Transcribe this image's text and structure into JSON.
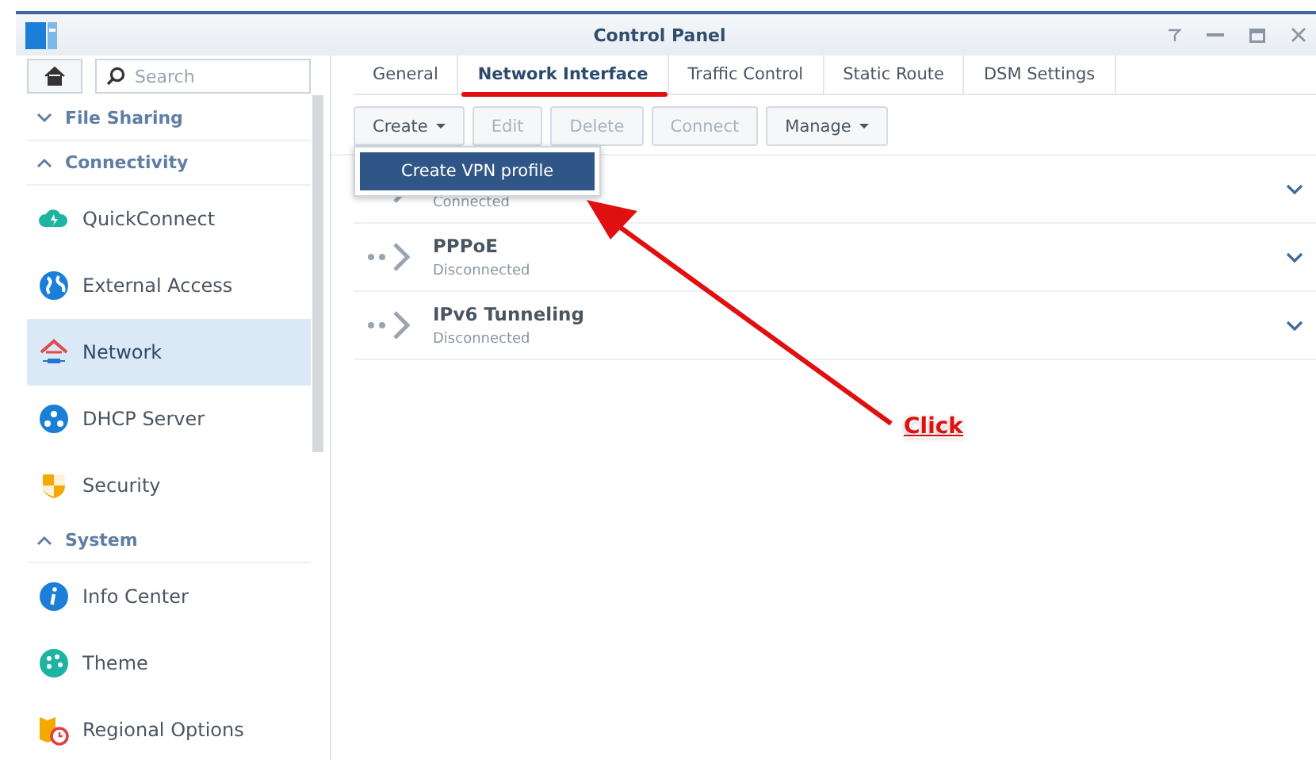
{
  "window": {
    "title": "Control Panel"
  },
  "sidebar": {
    "search": {
      "placeholder": "Search"
    },
    "items": [
      {
        "kind": "section",
        "label": "File Sharing",
        "expanded": false
      },
      {
        "kind": "section",
        "label": "Connectivity",
        "expanded": true
      },
      {
        "kind": "item",
        "label": "QuickConnect",
        "selected": false
      },
      {
        "kind": "item",
        "label": "External Access",
        "selected": false
      },
      {
        "kind": "item",
        "label": "Network",
        "selected": true
      },
      {
        "kind": "item",
        "label": "DHCP Server",
        "selected": false
      },
      {
        "kind": "item",
        "label": "Security",
        "selected": false
      },
      {
        "kind": "section",
        "label": "System",
        "expanded": true
      },
      {
        "kind": "item",
        "label": "Info Center",
        "selected": false
      },
      {
        "kind": "item",
        "label": "Theme",
        "selected": false
      },
      {
        "kind": "item",
        "label": "Regional Options",
        "selected": false
      }
    ]
  },
  "tabs": [
    {
      "label": "General",
      "selected": false,
      "annotated": false
    },
    {
      "label": "Network Interface",
      "selected": true,
      "annotated": true
    },
    {
      "label": "Traffic Control",
      "selected": false,
      "annotated": false
    },
    {
      "label": "Static Route",
      "selected": false,
      "annotated": false
    },
    {
      "label": "DSM Settings",
      "selected": false,
      "annotated": false
    }
  ],
  "toolbar": [
    {
      "label": "Create",
      "dropdown": true,
      "disabled": false
    },
    {
      "label": "Edit",
      "dropdown": false,
      "disabled": true
    },
    {
      "label": "Delete",
      "dropdown": false,
      "disabled": true
    },
    {
      "label": "Connect",
      "dropdown": false,
      "disabled": true
    },
    {
      "label": "Manage",
      "dropdown": true,
      "disabled": false
    }
  ],
  "dropdown_menu": {
    "items": [
      "Create VPN profile"
    ]
  },
  "interfaces": [
    {
      "status": "Connected"
    },
    {
      "name": "PPPoE",
      "status": "Disconnected"
    },
    {
      "name": "IPv6 Tunneling",
      "status": "Disconnected"
    }
  ],
  "annotation": {
    "label": "Click"
  }
}
